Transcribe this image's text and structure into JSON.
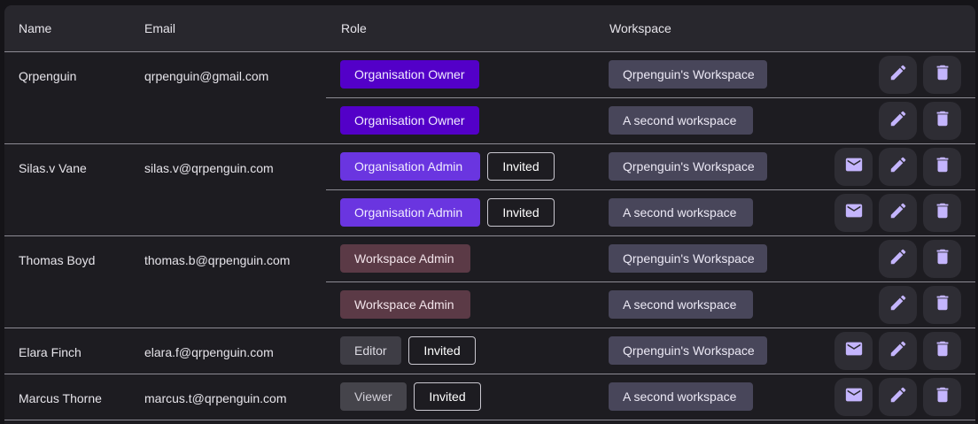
{
  "header": {
    "name": "Name",
    "email": "Email",
    "role": "Role",
    "workspace": "Workspace"
  },
  "icons": {
    "mail": "mail-icon",
    "edit": "pencil-icon",
    "delete": "trash-icon"
  },
  "colors": {
    "owner": "#5300c8",
    "admin": "#6a35e0",
    "workspace_admin": "#5b3a46",
    "editor": "#3e3d45",
    "viewer": "#45444b",
    "workspace_chip": "#48465a",
    "icon": "#c4b5fd"
  },
  "users": [
    {
      "name": "Qrpenguin",
      "email": "qrpenguin@gmail.com",
      "rows": [
        {
          "role": "Organisation Owner",
          "invited": "",
          "workspace": "Qrpenguin's Workspace"
        },
        {
          "role": "Organisation Owner",
          "invited": "",
          "workspace": "A second workspace"
        }
      ]
    },
    {
      "name": "Silas.v Vane",
      "email": "silas.v@qrpenguin.com",
      "rows": [
        {
          "role": "Organisation Admin",
          "invited": "Invited",
          "workspace": "Qrpenguin's Workspace"
        },
        {
          "role": "Organisation Admin",
          "invited": "Invited",
          "workspace": "A second workspace"
        }
      ]
    },
    {
      "name": "Thomas Boyd",
      "email": "thomas.b@qrpenguin.com",
      "rows": [
        {
          "role": "Workspace Admin",
          "invited": "",
          "workspace": "Qrpenguin's Workspace"
        },
        {
          "role": "Workspace Admin",
          "invited": "",
          "workspace": "A second workspace"
        }
      ]
    },
    {
      "name": "Elara Finch",
      "email": "elara.f@qrpenguin.com",
      "rows": [
        {
          "role": "Editor",
          "invited": "Invited",
          "workspace": "Qrpenguin's Workspace"
        }
      ]
    },
    {
      "name": "Marcus Thorne",
      "email": "marcus.t@qrpenguin.com",
      "rows": [
        {
          "role": "Viewer",
          "invited": "Invited",
          "workspace": "A second workspace"
        }
      ]
    }
  ]
}
